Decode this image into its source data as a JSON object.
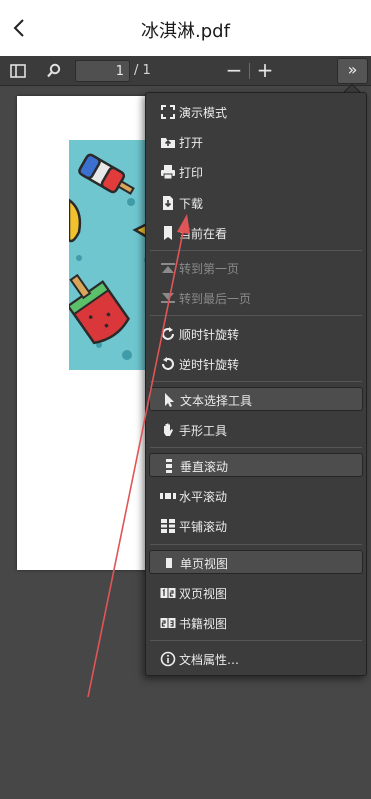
{
  "header": {
    "title": "冰淇淋.pdf",
    "back_icon": "chevron-left-icon"
  },
  "toolbar": {
    "sidebar_icon": "sidebar-toggle-icon",
    "search_icon": "search-icon",
    "page_value": "1",
    "page_total": "/ 1",
    "zoom_out": "−",
    "zoom_in": "+",
    "more": "»"
  },
  "menu": {
    "items": [
      {
        "label": "演示模式",
        "icon": "presentation-mode-icon"
      },
      {
        "label": "打开",
        "icon": "open-file-icon"
      },
      {
        "label": "打印",
        "icon": "print-icon"
      },
      {
        "label": "下载",
        "icon": "download-icon"
      },
      {
        "label": "当前在看",
        "icon": "bookmark-icon"
      },
      {
        "label": "转到第一页",
        "icon": "first-page-icon",
        "disabled": true
      },
      {
        "label": "转到最后一页",
        "icon": "last-page-icon",
        "disabled": true
      },
      {
        "label": "顺时针旋转",
        "icon": "rotate-clockwise-icon"
      },
      {
        "label": "逆时针旋转",
        "icon": "rotate-counterclockwise-icon"
      },
      {
        "label": "文本选择工具",
        "icon": "cursor-icon",
        "selected": true
      },
      {
        "label": "手形工具",
        "icon": "hand-icon"
      },
      {
        "label": "垂直滚动",
        "icon": "vertical-scroll-icon",
        "selected": true
      },
      {
        "label": "水平滚动",
        "icon": "horizontal-scroll-icon"
      },
      {
        "label": "平铺滚动",
        "icon": "wrapped-scroll-icon"
      },
      {
        "label": "单页视图",
        "icon": "single-page-icon",
        "selected": true
      },
      {
        "label": "双页视图",
        "icon": "odd-spread-icon"
      },
      {
        "label": "书籍视图",
        "icon": "even-spread-icon"
      },
      {
        "label": "文档属性…",
        "icon": "info-icon"
      }
    ]
  },
  "colors": {
    "annotation_arrow": "#e05555",
    "toolbar_bg": "#3b3b3b",
    "menu_bg": "#3c3c3c"
  }
}
